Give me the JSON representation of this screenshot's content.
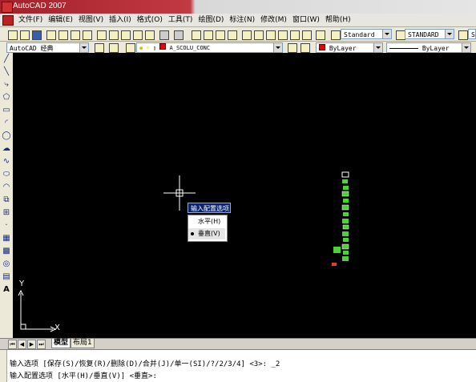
{
  "window": {
    "title": "AutoCAD 2007"
  },
  "menu": [
    "文件(F)",
    "编辑(E)",
    "视图(V)",
    "插入(I)",
    "格式(O)",
    "工具(T)",
    "绘图(D)",
    "标注(N)",
    "修改(M)",
    "窗口(W)",
    "帮助(H)"
  ],
  "toolbar_styles": {
    "text_style": "Standard",
    "dim_style": "STANDARD",
    "table_style_partial": "S"
  },
  "toolbar_layers": {
    "workspace": "AutoCAD 经典",
    "layer": "A_SCOLU_CONC",
    "color": "ByLayer",
    "linetype": "ByLayer"
  },
  "left_tools": [
    "line",
    "construction-line",
    "polyline",
    "polygon",
    "rectangle",
    "arc",
    "circle",
    "revision-cloud",
    "spline",
    "ellipse",
    "ellipse-arc",
    "insert-block",
    "make-block",
    "point",
    "hatch",
    "gradient",
    "region",
    "table",
    "multiline-text"
  ],
  "left_text_tool": "A",
  "context_menu": {
    "title": "输入配置选项",
    "items": [
      "水平(H)",
      "垂直(V)"
    ],
    "checked": "垂直(V)"
  },
  "ucs": {
    "x_label": "X",
    "y_label": "Y"
  },
  "layout_tabs": {
    "model": "模型",
    "layout1": "布局1"
  },
  "command_line": {
    "line1": "输入选项 [保存(S)/恢复(R)/删除(D)/合并(J)/单一(SI)/?/2/3/4] <3>: _2",
    "line2": "输入配置选项 [水平(H)/垂直(V)] <垂直>:"
  },
  "colors": {
    "canvas": "#000000",
    "accent": "#0a246a",
    "drawing": "#4cd137",
    "title_red": "#a3212b"
  }
}
